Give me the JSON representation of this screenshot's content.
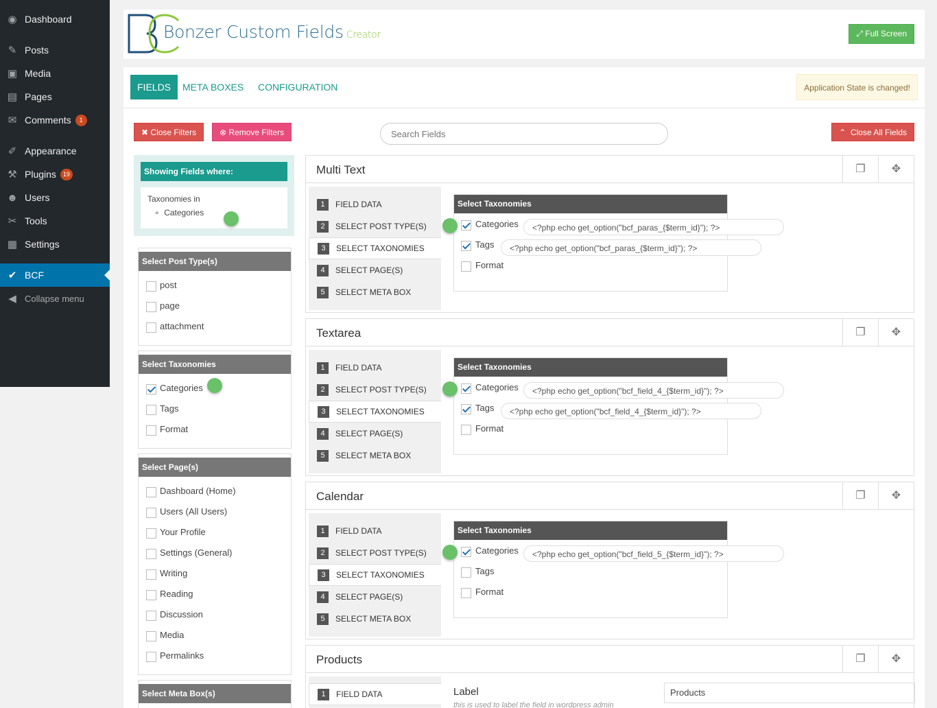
{
  "sidebar": {
    "items": [
      {
        "label": "Dashboard",
        "icon": "dashboard-icon",
        "glyph": "◉"
      },
      {
        "label": "Posts",
        "icon": "pin-icon",
        "glyph": "✎"
      },
      {
        "label": "Media",
        "icon": "media-icon",
        "glyph": "▣"
      },
      {
        "label": "Pages",
        "icon": "pages-icon",
        "glyph": "▤"
      },
      {
        "label": "Comments",
        "icon": "comments-icon",
        "glyph": "✉",
        "badge": "1"
      },
      {
        "label": "Appearance",
        "icon": "brush-icon",
        "glyph": "✐"
      },
      {
        "label": "Plugins",
        "icon": "plugin-icon",
        "glyph": "⚒",
        "badge": "19"
      },
      {
        "label": "Users",
        "icon": "user-icon",
        "glyph": "☻"
      },
      {
        "label": "Tools",
        "icon": "wrench-icon",
        "glyph": "✂"
      },
      {
        "label": "Settings",
        "icon": "settings-icon",
        "glyph": "▦"
      },
      {
        "label": "BCF",
        "icon": "check-circle-icon",
        "glyph": "✔"
      },
      {
        "label": "Collapse menu",
        "icon": "collapse-icon",
        "glyph": "◀"
      }
    ]
  },
  "header": {
    "title": "Bonzer Custom Fields",
    "subtitle": "Creator",
    "fullscreen": "Full Screen"
  },
  "tabs": [
    "FIELDS",
    "META BOXES",
    "CONFIGURATION"
  ],
  "app_state": "Application State is changed!",
  "toolbar": {
    "close_filters": "Close Filters",
    "remove_filters": "Remove Filters",
    "search_placeholder": "Search Fields",
    "close_all": "Close All Fields"
  },
  "filter_summary": {
    "title": "Showing Fields where:",
    "line": "Taxonomies in",
    "item": "Categories"
  },
  "post_types": {
    "title": "Select Post Type(s)",
    "items": [
      "post",
      "page",
      "attachment"
    ]
  },
  "taxonomies": {
    "title": "Select Taxonomies",
    "items": [
      "Categories",
      "Tags",
      "Format"
    ]
  },
  "pages": {
    "title": "Select Page(s)",
    "items": [
      "Dashboard (Home)",
      "Users (All Users)",
      "Your Profile",
      "Settings (General)",
      "Writing",
      "Reading",
      "Discussion",
      "Media",
      "Permalinks"
    ]
  },
  "metaboxes": {
    "title": "Select Meta Box(s)"
  },
  "steps": [
    "FIELD DATA",
    "SELECT POST TYPE(S)",
    "SELECT TAXONOMIES",
    "SELECT PAGE(S)",
    "SELECT META BOX"
  ],
  "tax_panel_title": "Select Taxonomies",
  "fields": [
    {
      "title": "Multi Text",
      "codes": [
        "<?php echo get_option(\"bcf_paras_{$term_id}\"); ?>",
        "<?php echo get_option(\"bcf_paras_{$term_id}\"); ?>"
      ]
    },
    {
      "title": "Textarea",
      "codes": [
        "<?php echo get_option(\"bcf_field_4_{$term_id}\"); ?>",
        "<?php echo get_option(\"bcf_field_4_{$term_id}\"); ?>"
      ]
    },
    {
      "title": "Calendar",
      "codes": [
        "<?php echo get_option(\"bcf_field_5_{$term_id}\"); ?>"
      ]
    },
    {
      "title": "Products",
      "label": "Label",
      "label_help": "this is used to label the field in wordpress admin",
      "label_value": "Products"
    }
  ]
}
